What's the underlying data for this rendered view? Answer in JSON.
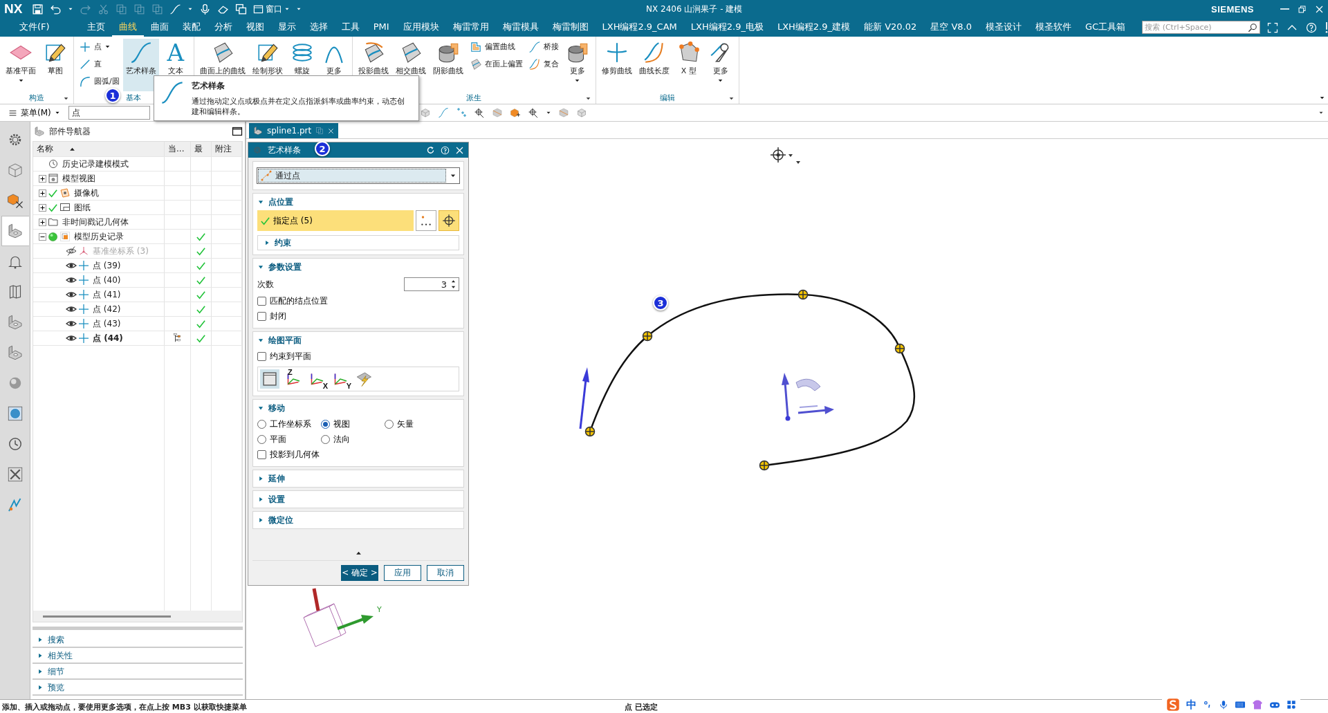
{
  "title_bar": {
    "logo": "NX",
    "window_menu": "窗口",
    "title": "NX 2406 山涧果子 - 建模",
    "brand": "SIEMENS"
  },
  "menu_bar": {
    "items": [
      {
        "label": "文件(F)",
        "selected": false
      },
      {
        "label": "主页",
        "selected": false
      },
      {
        "label": "曲线",
        "selected": true
      },
      {
        "label": "曲面",
        "selected": false
      },
      {
        "label": "装配",
        "selected": false
      },
      {
        "label": "分析",
        "selected": false
      },
      {
        "label": "视图",
        "selected": false
      },
      {
        "label": "显示",
        "selected": false
      },
      {
        "label": "选择",
        "selected": false
      },
      {
        "label": "工具",
        "selected": false
      },
      {
        "label": "PMI",
        "selected": false
      },
      {
        "label": "应用模块",
        "selected": false
      },
      {
        "label": "梅雷常用",
        "selected": false
      },
      {
        "label": "梅雷模具",
        "selected": false
      },
      {
        "label": "梅雷制图",
        "selected": false
      },
      {
        "label": "LXH编程2.9_CAM",
        "selected": false
      },
      {
        "label": "LXH编程2.9_电极",
        "selected": false
      },
      {
        "label": "LXH编程2.9_建模",
        "selected": false
      },
      {
        "label": "能新 V20.02",
        "selected": false
      },
      {
        "label": "星空 V8.0",
        "selected": false
      },
      {
        "label": "模圣设计",
        "selected": false
      },
      {
        "label": "模圣软件",
        "selected": false
      },
      {
        "label": "GC工具箱",
        "selected": false
      }
    ],
    "search": {
      "placeholder": "搜索 (Ctrl+Space)"
    }
  },
  "ribbon": {
    "callout": "1",
    "groups": [
      {
        "label": "构造",
        "launcher": true,
        "columns": [
          [
            {
              "label": "基准平面",
              "kind": "large",
              "dropdown": true,
              "selected": false
            }
          ],
          [
            {
              "label": "草图",
              "kind": "large",
              "dropdown": false,
              "selected": false
            }
          ]
        ]
      },
      {
        "label": "基本",
        "launcher": false,
        "columns": [
          [
            {
              "label": "点",
              "kind": "small",
              "dropdown": true,
              "selected": false
            },
            {
              "label": "直",
              "kind": "small",
              "dropdown": false,
              "selected": false
            },
            {
              "label": "圆弧/圆",
              "kind": "small",
              "dropdown": false,
              "selected": false
            }
          ],
          [
            {
              "label": "艺术样条",
              "kind": "large",
              "dropdown": false,
              "selected": true
            }
          ],
          [
            {
              "label": "文本",
              "kind": "glyph",
              "glyph": "A",
              "dropdown": false,
              "selected": false
            }
          ]
        ]
      },
      {
        "launcher": false,
        "columns": [
          [
            {
              "label": "曲面上的曲线",
              "kind": "large",
              "selected": false
            }
          ],
          [
            {
              "label": "绘制形状",
              "kind": "large",
              "selected": false
            }
          ],
          [
            {
              "label": "螺旋",
              "kind": "large",
              "selected": false
            }
          ],
          [
            {
              "label": "更多",
              "kind": "large",
              "selected": false
            }
          ]
        ]
      },
      {
        "label": "派生",
        "launcher": true,
        "columns": [
          [
            {
              "label": "投影曲线",
              "kind": "large",
              "selected": false
            }
          ],
          [
            {
              "label": "相交曲线",
              "kind": "large",
              "dropdown": false,
              "selected": false
            }
          ],
          [
            {
              "label": "阴影曲线",
              "kind": "large",
              "dropdown": false,
              "selected": false
            }
          ],
          [
            {
              "label": "偏置曲线",
              "kind": "small",
              "dropdown": false,
              "selected": false
            },
            {
              "label": "在面上偏置",
              "kind": "small",
              "dropdown": false,
              "selected": false
            }
          ],
          [
            {
              "label": "桥接",
              "kind": "small",
              "dropdown": false,
              "selected": false
            },
            {
              "label": "复合",
              "kind": "small",
              "dropdown": false,
              "selected": false
            }
          ],
          [
            {
              "label": "更多",
              "kind": "large",
              "dropdown": true,
              "selected": false
            }
          ]
        ]
      },
      {
        "label": "编辑",
        "launcher": true,
        "columns": [
          [
            {
              "label": "修剪曲线",
              "kind": "large",
              "dropdown": false,
              "selected": false
            }
          ],
          [
            {
              "label": "曲线长度",
              "kind": "large",
              "dropdown": false,
              "selected": false
            }
          ],
          [
            {
              "label": "X 型",
              "kind": "large",
              "dropdown": false,
              "selected": false
            }
          ],
          [
            {
              "label": "更多",
              "kind": "large",
              "dropdown": true,
              "selected": false
            }
          ]
        ]
      }
    ]
  },
  "tooltip": {
    "title": "艺术样条",
    "text": "通过拖动定义点或极点并在定义点指派斜率或曲率约束，动态创建和编辑样条。"
  },
  "toolbar": {
    "menu": "菜单(M)",
    "filter": "点"
  },
  "tool_strip": [
    {
      "selected": false
    },
    {
      "selected": false
    },
    {
      "selected": false
    },
    {
      "selected": true
    },
    {
      "selected": false
    },
    {
      "selected": false
    },
    {
      "selected": false
    },
    {
      "selected": false
    },
    {
      "selected": false
    },
    {
      "selected": false
    },
    {
      "selected": false
    },
    {
      "selected": false
    },
    {
      "selected": false
    }
  ],
  "navigator": {
    "title": "部件导航器",
    "columns": [
      "名称",
      "当...",
      "最",
      "附注"
    ],
    "rows": [
      {
        "label": "历史记录建模模式",
        "kind": "clock",
        "checked": false,
        "latest": false,
        "current": false
      },
      {
        "label": "模型视图",
        "kind": "view",
        "expanded": false,
        "checked": false,
        "latest": false,
        "current": false
      },
      {
        "label": "摄像机",
        "kind": "camera",
        "expanded": false,
        "checked": true,
        "latest": false,
        "current": false
      },
      {
        "label": "图纸",
        "kind": "drawing",
        "expanded": false,
        "checked": true,
        "latest": false,
        "current": false
      },
      {
        "label": "非时间戳记几何体",
        "kind": "folder",
        "expanded": false,
        "checked": false,
        "latest": false,
        "current": false
      },
      {
        "label": "模型历史记录",
        "kind": "history",
        "expanded": true,
        "checked": false,
        "latest": true,
        "current": false,
        "children": [
          {
            "label": "基准坐标系 (3)",
            "kind": "csys",
            "visible": false,
            "latest": true,
            "current": false
          },
          {
            "label": "点 (39)",
            "kind": "point",
            "visible": true,
            "latest": true,
            "current": false
          },
          {
            "label": "点 (40)",
            "kind": "point",
            "visible": true,
            "latest": true,
            "current": false
          },
          {
            "label": "点 (41)",
            "kind": "point",
            "visible": true,
            "latest": true,
            "current": false
          },
          {
            "label": "点 (42)",
            "kind": "point",
            "visible": true,
            "latest": true,
            "current": false
          },
          {
            "label": "点 (43)",
            "kind": "point",
            "visible": true,
            "latest": true,
            "current": false
          },
          {
            "label": "点 (44)",
            "kind": "point",
            "visible": true,
            "latest": true,
            "current": true
          }
        ]
      }
    ],
    "sections": [
      "搜索",
      "相关性",
      "细节",
      "预览"
    ]
  },
  "tab": {
    "label": "spline1.prt"
  },
  "dialog": {
    "title": "艺术样条",
    "callout": "2",
    "type": "通过点",
    "point_position": {
      "title": "点位置",
      "expanded": true,
      "specify": {
        "label": "指定点 (5)",
        "done": true
      },
      "constraints": {
        "title": "约束",
        "expanded": false
      }
    },
    "parameters": {
      "title": "参数设置",
      "expanded": true,
      "degree_label": "次数",
      "degree": "3",
      "options": [
        {
          "label": "匹配的结点位置",
          "checked": false
        },
        {
          "label": "封闭",
          "checked": false
        }
      ]
    },
    "drawing_plane": {
      "title": "绘图平面",
      "expanded": true,
      "constrain": {
        "label": "约束到平面",
        "checked": false
      },
      "planes": [
        {
          "selected": true
        },
        {
          "selected": false,
          "axis": "Z"
        },
        {
          "selected": false,
          "axis": "X"
        },
        {
          "selected": false,
          "axis": "Y"
        },
        {
          "selected": false
        }
      ]
    },
    "move": {
      "title": "移动",
      "expanded": true,
      "options": [
        {
          "label": "工作坐标系",
          "selected": false
        },
        {
          "label": "视图",
          "selected": true
        },
        {
          "label": "矢量",
          "selected": false
        },
        {
          "label": "平面",
          "selected": false
        },
        {
          "label": "法向",
          "selected": false
        }
      ],
      "project": {
        "label": "投影到几何体",
        "checked": false
      }
    },
    "collapsed": [
      {
        "title": "延伸",
        "expanded": false
      },
      {
        "title": "设置",
        "expanded": false
      },
      {
        "title": "微定位",
        "expanded": false
      }
    ],
    "buttons": [
      {
        "label": "< 确定 >",
        "kind": "primary"
      },
      {
        "label": "应用",
        "kind": "normal"
      },
      {
        "label": "取消",
        "kind": "normal"
      }
    ]
  },
  "canvas": {
    "callout": "3",
    "axis_label": "Y"
  },
  "status_bar": {
    "message": "添加、插入或拖动点，要使用更多选项，在点上按 MB3 以获取快捷菜单",
    "selection": "点 已选定"
  },
  "ime_bar": {
    "mode": "中"
  }
}
